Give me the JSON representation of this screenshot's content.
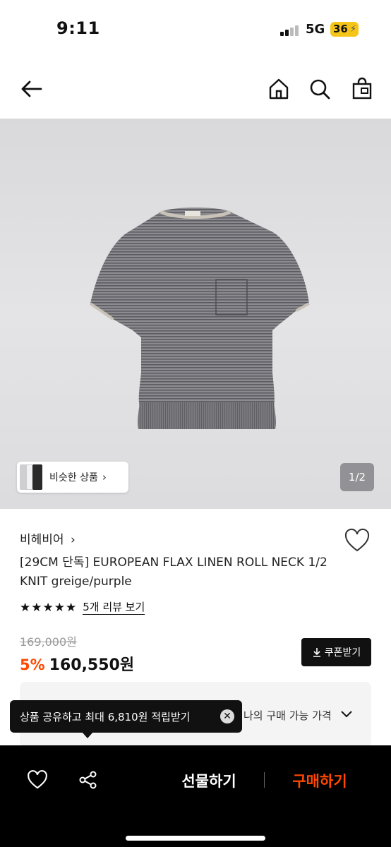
{
  "status": {
    "time": "9:11",
    "network": "5G",
    "battery": "36"
  },
  "nav": {
    "icons": [
      "back-arrow-icon",
      "home-icon",
      "search-icon",
      "shopping-bag-icon"
    ]
  },
  "hero": {
    "similar_label": "비슷한 상품",
    "pager": "1/2",
    "pager_current": 1,
    "pager_total": 2
  },
  "product": {
    "brand": "비헤비어",
    "title": "[29CM 단독] EUROPEAN FLAX LINEN ROLL NECK 1/2 KNIT greige/purple",
    "rating_stars": 5,
    "review_link": "5개 리뷰 보기",
    "original_price": "169,000원",
    "discount": "5%",
    "sale_price": "160,550원",
    "coupon_label": "쿠폰받기"
  },
  "my_price": {
    "label": "나의 구매 가능 가격"
  },
  "tooltip": {
    "text": "상품 공유하고 최대 6,810원 적립받기"
  },
  "bottom": {
    "gift_label": "선물하기",
    "buy_label": "구매하기"
  },
  "colors": {
    "accent": "#ff4800",
    "dark": "#000000",
    "bg": "#ffffff"
  }
}
